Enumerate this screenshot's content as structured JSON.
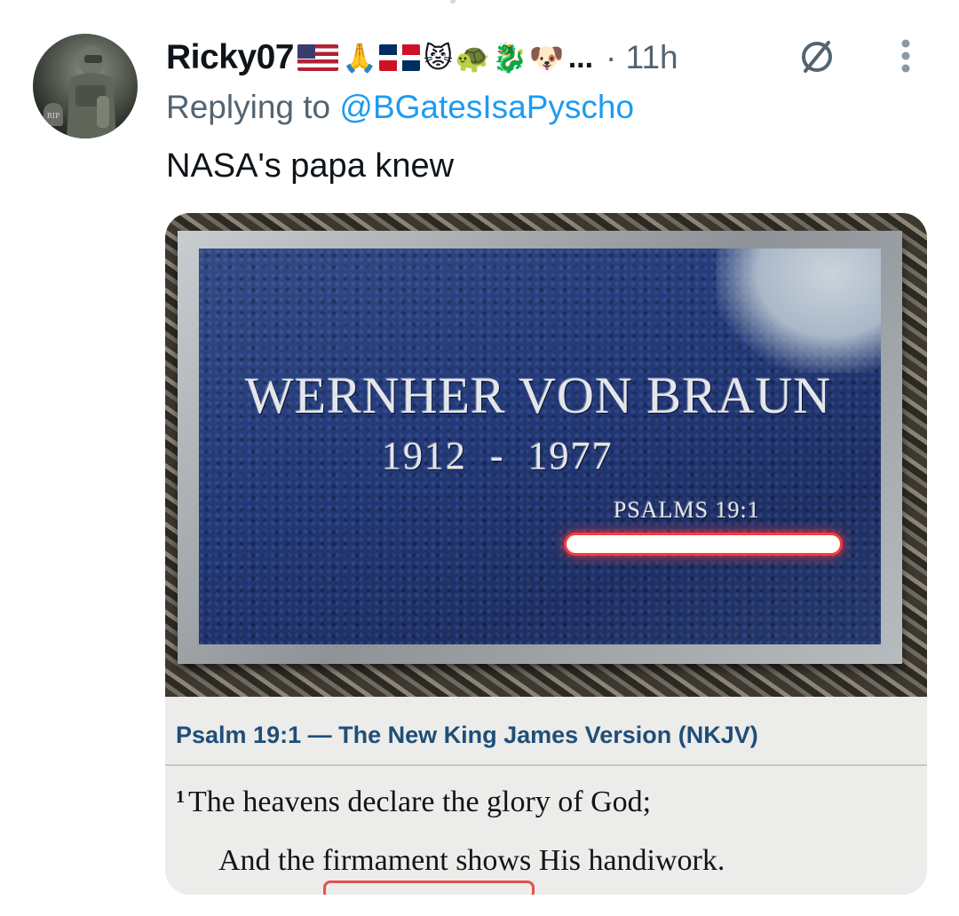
{
  "tweet": {
    "author": {
      "display_name": "Ricky07",
      "name_emojis": [
        "flag-us",
        "🙏",
        "flag-do",
        "😾",
        "🐢",
        "🐉",
        "🐶"
      ],
      "truncation": "...",
      "avatar_badge": "RIP"
    },
    "separator": "·",
    "timestamp": "11h",
    "reply_prefix": "Replying to",
    "reply_handle": "@BGatesIsaPyscho",
    "text": "NASA's papa knew",
    "icons": {
      "edited": "circle-slash-icon",
      "more": "vertical-ellipsis-icon"
    }
  },
  "media": {
    "plaque": {
      "name": "WERNHER VON BRAUN",
      "years": "1912  -  1977",
      "reference": "PSALMS 19:1"
    },
    "bible": {
      "heading": "Psalm 19:1 — The New King James Version (NKJV)",
      "verse_number": "1",
      "line1": "The heavens declare the glory of God;",
      "line2": "And the firmament shows His handiwork."
    }
  },
  "colors": {
    "text_primary": "#0f1419",
    "text_secondary": "#536471",
    "link": "#1d9bf0",
    "bible_heading": "#1f4e79",
    "plaque_blue": "#22397a",
    "highlight_red": "#ff3a3a"
  }
}
